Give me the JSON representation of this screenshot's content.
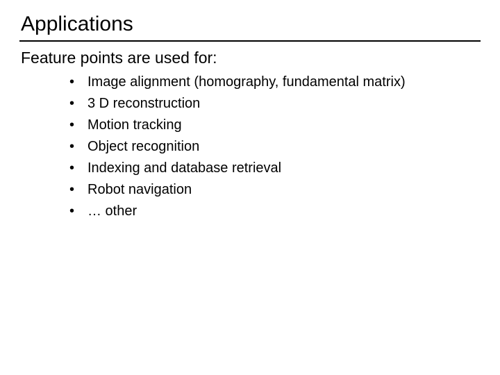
{
  "title": "Applications",
  "intro": "Feature points are used for:",
  "bullets": [
    "Image alignment (homography, fundamental matrix)",
    "3 D reconstruction",
    "Motion tracking",
    "Object recognition",
    "Indexing and database retrieval",
    "Robot navigation",
    "… other"
  ]
}
